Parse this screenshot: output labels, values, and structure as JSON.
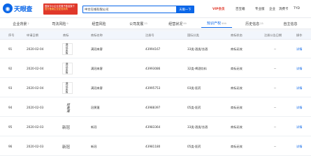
{
  "header": {
    "logo_text": "天眼查",
    "promo_line1": "国家中小企业发展子基金旗下",
    "promo_line2": "官方备案企业征信机构",
    "search_value": "中文在线有限公司",
    "search_button": "天眼一下",
    "nav": {
      "vip": "VIP会员",
      "app": "百宝箱",
      "pro": "专业版",
      "enterprise": "企业",
      "login": "消费卡",
      "user": "TYD"
    }
  },
  "tabs": [
    {
      "label": "企业背景",
      "count": "2"
    },
    {
      "label": "司法风险",
      "count": "9"
    },
    {
      "label": "经营风险",
      "count": ""
    },
    {
      "label": "公司发展",
      "count": "33"
    },
    {
      "label": "经营状况",
      "count": "99"
    },
    {
      "label": "知识产权",
      "count": "999"
    },
    {
      "label": "历史信息",
      "count": "25"
    },
    {
      "label": "自主信息",
      "count": ""
    }
  ],
  "table": {
    "headers": [
      "序号",
      "申请日期",
      "商标",
      "商标名称",
      "注册号",
      "国际分类",
      "商标状态",
      "注册公告日期",
      "操作"
    ],
    "rows": [
      {
        "index": "91",
        "date": "2020-02-04",
        "mark_text": "满冠来客",
        "mark_style": "vertical",
        "name": "满冠来客",
        "reg_no": "43994167",
        "category": "33类-酒类/含酒",
        "status": "商标无效",
        "announce": "--",
        "action": "详情"
      },
      {
        "index": "92",
        "date": "2020-02-04",
        "mark_text": "满冠来客",
        "mark_style": "vertical",
        "name": "满冠来客",
        "reg_no": "43993086",
        "category": "32类-啤酒饮料",
        "status": "商标无效",
        "announce": "--",
        "action": "详情"
      },
      {
        "index": "93",
        "date": "2020-02-04",
        "mark_text": "满冠来客",
        "mark_style": "vertical",
        "name": "满冠来客",
        "reg_no": "43995753",
        "category": "03类-医药",
        "status": "商标无效",
        "announce": "--",
        "action": "详情"
      },
      {
        "index": "94",
        "date": "2020-02-03",
        "mark_text": "冠黄蓬",
        "mark_style": "script",
        "name": "冠黄蓬",
        "reg_no": "43988397",
        "category": "05类-医药",
        "status": "商标无效",
        "announce": "--",
        "action": "详情"
      },
      {
        "index": "95",
        "date": "2020-02-03",
        "mark_text": "新冠",
        "mark_style": "word",
        "name": "新冠",
        "reg_no": "43983364",
        "category": "33类-酒类/含酒",
        "status": "商标无效",
        "announce": "--",
        "action": "详情"
      },
      {
        "index": "96",
        "date": "2020-02-03",
        "mark_text": "新冠",
        "mark_style": "word",
        "name": "新冠",
        "reg_no": "43981180",
        "category": "05类-医药",
        "status": "商标无效",
        "announce": "--",
        "action": "详情"
      }
    ]
  }
}
